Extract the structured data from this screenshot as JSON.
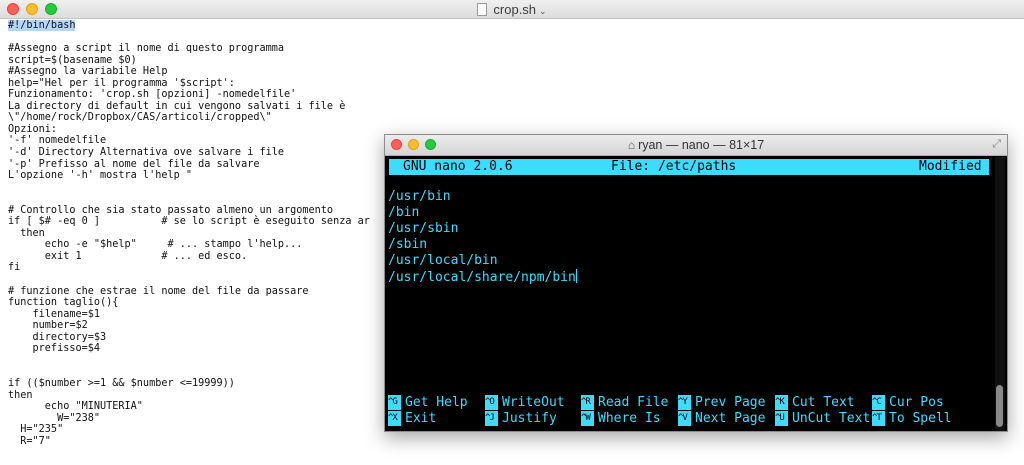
{
  "editor": {
    "title": "crop.sh",
    "title_chevron": "⌄",
    "lines": [
      "#!/bin/bash",
      "",
      "#Assegno a script il nome di questo programma",
      "script=$(basename $0)",
      "#Assegno la variabile Help",
      "help=\"Hel per il programma '$script':",
      "Funzionamento: 'crop.sh [opzioni] -nomedelfile'",
      "La directory di default in cui vengono salvati i file è",
      "\\\"/home/rock/Dropbox/CAS/articoli/cropped\\\"",
      "Opzioni:",
      "'-f' nomedelfile",
      "'-d' Directory Alternativa ove salvare i file",
      "'-p' Prefisso al nome del file da salvare",
      "L'opzione '-h' mostra l'help \"",
      "",
      "",
      "# Controllo che sia stato passato almeno un argomento",
      "if [ $# -eq 0 ]          # se lo script è eseguito senza ar",
      "  then",
      "      echo -e \"$help\"     # ... stampo l'help...",
      "      exit 1             # ... ed esco.",
      "fi",
      "",
      "# funzione che estrae il nome del file da passare",
      "function taglio(){",
      "    filename=$1",
      "    number=$2",
      "    directory=$3",
      "    prefisso=$4",
      "",
      "",
      "if (($number >=1 && $number <=19999))",
      "then",
      "      echo \"MINUTERIA\"",
      "        W=\"238\"",
      "  H=\"235\"",
      "  R=\"7\""
    ]
  },
  "terminal": {
    "title": "ryan — nano — 81×17",
    "home_icon": "⌂",
    "resize_icon": "⤢",
    "nano": {
      "version": "GNU nano 2.0.6",
      "file": "File: /etc/paths",
      "status": "Modified"
    },
    "paths": [
      "/usr/bin",
      "/bin",
      "/usr/sbin",
      "/sbin",
      "/usr/local/bin",
      "/usr/local/share/npm/bin"
    ],
    "shortcuts_row1": [
      {
        "key": "^G",
        "label": "Get Help"
      },
      {
        "key": "^O",
        "label": "WriteOut"
      },
      {
        "key": "^R",
        "label": "Read File"
      },
      {
        "key": "^Y",
        "label": "Prev Page"
      },
      {
        "key": "^K",
        "label": "Cut Text"
      },
      {
        "key": "^C",
        "label": "Cur Pos"
      }
    ],
    "shortcuts_row2": [
      {
        "key": "^X",
        "label": "Exit"
      },
      {
        "key": "^J",
        "label": "Justify"
      },
      {
        "key": "^W",
        "label": "Where Is"
      },
      {
        "key": "^V",
        "label": "Next Page"
      },
      {
        "key": "^U",
        "label": "UnCut Text"
      },
      {
        "key": "^T",
        "label": "To Spell"
      }
    ]
  },
  "colors": {
    "terminal_text": "#3cdcff",
    "terminal_bg": "#000000",
    "selection": "#b4d5fe"
  }
}
